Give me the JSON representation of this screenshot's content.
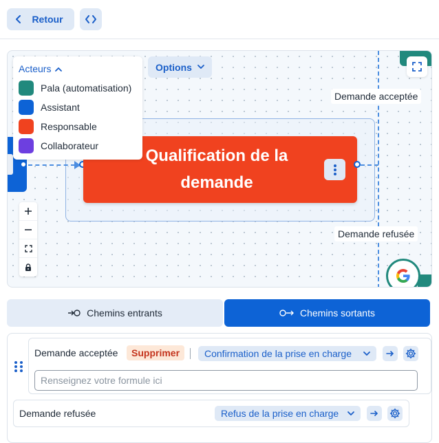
{
  "topbar": {
    "back_label": "Retour"
  },
  "canvas": {
    "legend": {
      "title": "Acteurs",
      "items": [
        {
          "label": "Pala (automatisation)",
          "color": "#21897d"
        },
        {
          "label": "Assistant",
          "color": "#0d63d6"
        },
        {
          "label": "Responsable",
          "color": "#f0421f"
        },
        {
          "label": "Collaborateur",
          "color": "#6d3fe0"
        }
      ]
    },
    "options_label": "Options",
    "node_title": "Qualification de la demande",
    "edge_labels": {
      "accepted": "Demande acceptée",
      "refused": "Demande refusée"
    },
    "badge_letter": "G"
  },
  "tabs": {
    "incoming": "Chemins entrants",
    "outgoing": "Chemins sortants"
  },
  "paths": [
    {
      "name": "Demande acceptée",
      "delete_label": "Supprimer",
      "target": "Confirmation de la prise en charge",
      "formula_placeholder": "Renseignez votre formule ici"
    },
    {
      "name": "Demande refusée",
      "target": "Refus de la prise en charge"
    }
  ]
}
